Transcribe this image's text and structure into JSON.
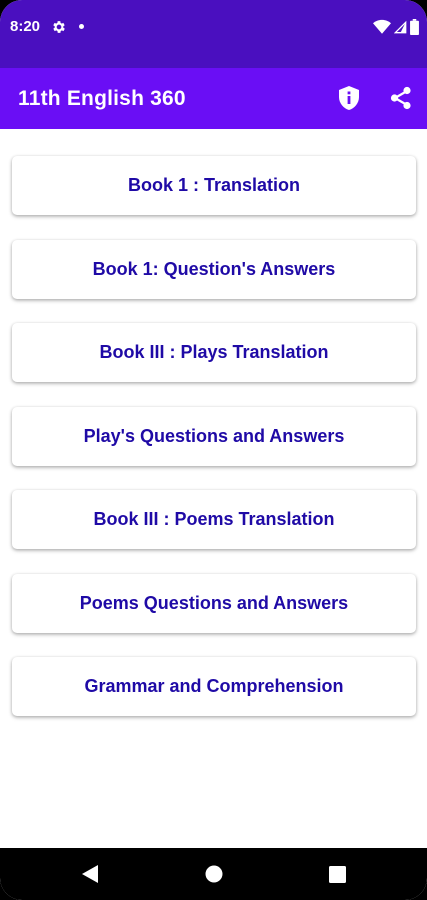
{
  "status_bar": {
    "time": "8:20",
    "icons": [
      "gear-icon",
      "notification-dot-icon",
      "wifi-icon",
      "cell-signal-icon",
      "battery-icon"
    ]
  },
  "app_bar": {
    "title": "11th English 360",
    "actions": [
      "privacy-shield-icon",
      "share-icon"
    ]
  },
  "menu": {
    "items": [
      {
        "label": "Book 1 : Translation"
      },
      {
        "label": "Book 1: Question's Answers"
      },
      {
        "label": "Book III : Plays Translation"
      },
      {
        "label": "Play's Questions and Answers"
      },
      {
        "label": "Book III : Poems Translation"
      },
      {
        "label": "Poems Questions and Answers"
      },
      {
        "label": "Grammar and Comprehension"
      }
    ]
  },
  "nav_bar": {
    "buttons": [
      "back-icon",
      "home-icon",
      "recents-icon"
    ]
  },
  "colors": {
    "status_bar": "#4a0fbf",
    "app_bar": "#6a0ef5",
    "menu_text": "#1f0aa6",
    "background": "#ffffff"
  }
}
